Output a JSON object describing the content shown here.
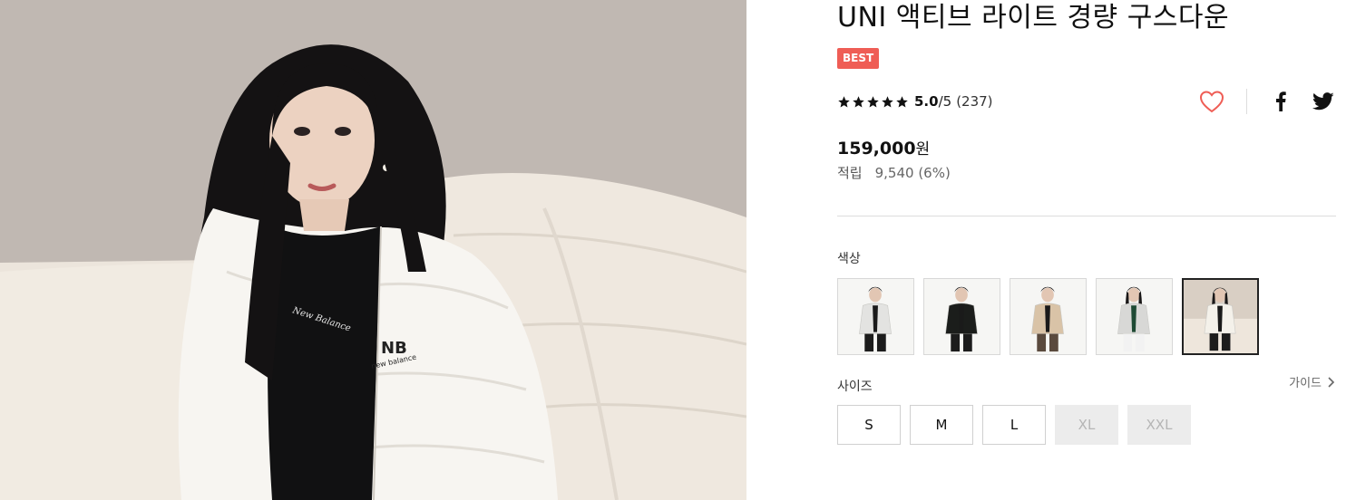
{
  "product": {
    "title": "UNI 액티브 라이트 경량 구스다운",
    "badge": "BEST",
    "rating": {
      "stars": 5,
      "score": "5.0",
      "max": "/5",
      "count": "(237)"
    },
    "price": {
      "amount": "159,000",
      "currency": "원"
    },
    "points": {
      "label": "적립",
      "value": "9,540 (6%)"
    }
  },
  "share": {
    "icons": [
      "heart-icon",
      "facebook-icon",
      "twitter-icon"
    ],
    "heart_color": "#ef5d55"
  },
  "colors": {
    "label": "색상",
    "selected_index": 4,
    "options": [
      {
        "name": "swatch-light-gray-male",
        "jacket": "#e3e3e1"
      },
      {
        "name": "swatch-black-male",
        "jacket": "#1b1d1b"
      },
      {
        "name": "swatch-beige-male",
        "jacket": "#d9c3a7"
      },
      {
        "name": "swatch-light-gray-female",
        "jacket": "#d8d8d6"
      },
      {
        "name": "swatch-white-female",
        "jacket": "#f4f1ea"
      }
    ]
  },
  "sizes": {
    "label": "사이즈",
    "guide_label": "가이드",
    "options": [
      {
        "label": "S",
        "available": true
      },
      {
        "label": "M",
        "available": true
      },
      {
        "label": "L",
        "available": true
      },
      {
        "label": "XL",
        "available": false
      },
      {
        "label": "XXL",
        "available": false
      }
    ]
  },
  "hero": {
    "jacket_logo": "new balance",
    "shirt_text": "New Balance",
    "accent": "#ef5d55"
  }
}
